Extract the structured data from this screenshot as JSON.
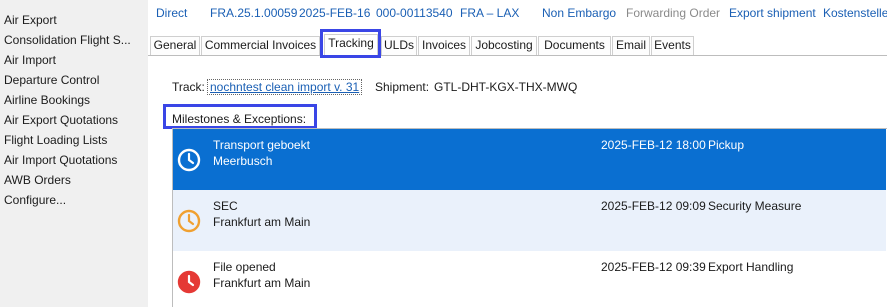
{
  "sidebar": {
    "items": [
      {
        "label": "Air Export"
      },
      {
        "label": "Consolidation Flight S..."
      },
      {
        "label": "Air Import"
      },
      {
        "label": "Departure Control"
      },
      {
        "label": "Airline Bookings"
      },
      {
        "label": "Air Export Quotations"
      },
      {
        "label": "Flight Loading Lists"
      },
      {
        "label": "Air Import Quotations"
      },
      {
        "label": "AWB Orders"
      },
      {
        "label": "Configure..."
      }
    ]
  },
  "header": {
    "mode": "Direct",
    "file_ref": "FRA.25.1.00059",
    "date": "2025-FEB-16",
    "awb": "000-00113540",
    "route": "FRA – LAX",
    "embargo": "Non Embargo",
    "forwarding": "Forwarding Order",
    "export": "Export shipment",
    "cost_center": "Kostenstelle"
  },
  "tabs": [
    {
      "label": "General"
    },
    {
      "label": "Commercial Invoices"
    },
    {
      "label": "Tracking"
    },
    {
      "label": "ULDs"
    },
    {
      "label": "Invoices"
    },
    {
      "label": "Jobcosting"
    },
    {
      "label": "Documents"
    },
    {
      "label": "Email"
    },
    {
      "label": "Events"
    }
  ],
  "tracking": {
    "track_label": "Track:",
    "track_value": "nochntest clean import v. 31",
    "shipment_label": "Shipment:",
    "shipment_value": "GTL-DHT-KGX-THX-MWQ",
    "milestones_label": "Milestones & Exceptions:"
  },
  "milestones": [
    {
      "title": "Transport geboekt",
      "location": "Meerbusch",
      "datetime": "2025-FEB-12 18:00",
      "type": "Pickup",
      "icon": "clock-icon",
      "color": "#ffffff",
      "bg": "#0a6fd1",
      "selected": true
    },
    {
      "title": "SEC",
      "location": "Frankfurt am Main",
      "datetime": "2025-FEB-12 09:09",
      "type": "Security Measure",
      "icon": "clock-icon",
      "color": "#f0a030",
      "bg": "#eaf1fb",
      "selected": false
    },
    {
      "title": "File opened",
      "location": "Frankfurt am Main",
      "datetime": "2025-FEB-12 09:39",
      "type": "Export Handling",
      "icon": "clock-icon",
      "color": "#e53935",
      "bg": "#ffffff",
      "selected": false
    }
  ],
  "colors": {
    "accent": "#1a5fb4",
    "highlight": "#3a46e6",
    "selected_row": "#0a6fd1"
  }
}
